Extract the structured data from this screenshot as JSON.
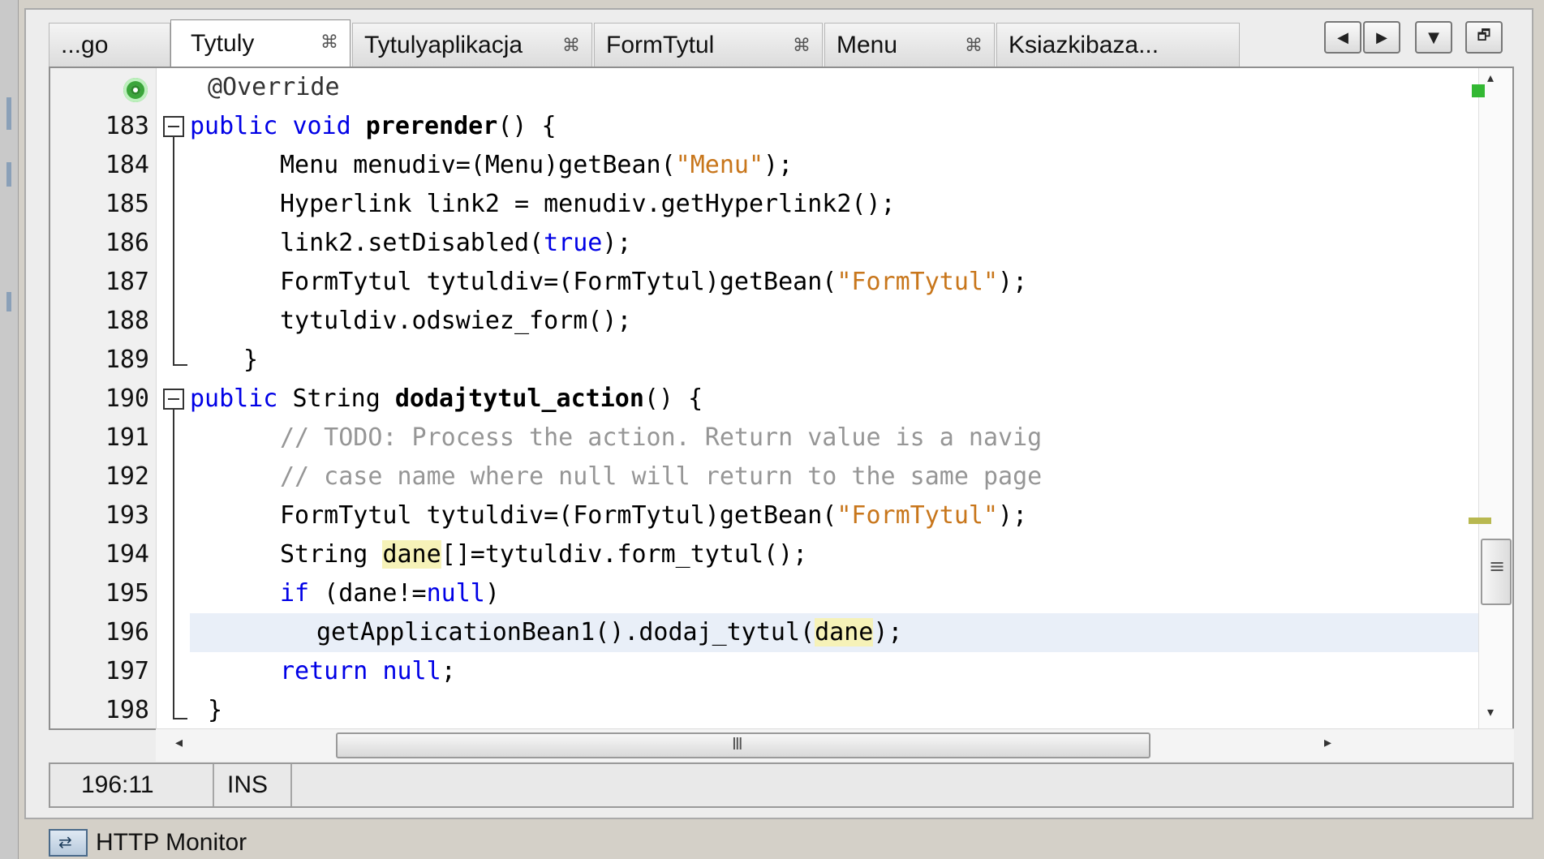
{
  "tabs": [
    {
      "label": "...go",
      "closable": false
    },
    {
      "label": "Tytuly",
      "closable": true,
      "active": true
    },
    {
      "label": "Tytulyaplikacja",
      "closable": true
    },
    {
      "label": "FormTytul",
      "closable": true
    },
    {
      "label": "Menu",
      "closable": true
    },
    {
      "label": "Ksiazkibaza...",
      "closable": false
    }
  ],
  "tab_close_glyph": "⌘",
  "nav": {
    "left": "◀",
    "right": "▶",
    "dropdown": "▼",
    "restore": "🗗"
  },
  "editor": {
    "line_numbers": [
      "",
      "183",
      "184",
      "185",
      "186",
      "187",
      "188",
      "189",
      "190",
      "191",
      "192",
      "193",
      "194",
      "195",
      "196",
      "197",
      "198"
    ],
    "annotation": "@Override",
    "lines": {
      "l183": {
        "kw1": "public",
        "kw2": "void",
        "name": "prerender",
        "rest": "() {"
      },
      "l184": {
        "pre": "Menu menudiv=(Menu)getBean(",
        "str": "\"Menu\"",
        "post": ");"
      },
      "l185": "Hyperlink link2 = menudiv.getHyperlink2();",
      "l186": {
        "pre": "link2.setDisabled(",
        "kw": "true",
        "post": ");"
      },
      "l187": {
        "pre": "FormTytul tytuldiv=(FormTytul)getBean(",
        "str": "\"FormTytul\"",
        "post": ");"
      },
      "l188": "tytuldiv.odswiez_form();",
      "l189": "}",
      "l190": {
        "kw1": "public",
        "type": "String",
        "name": "dodajtytul_action",
        "rest": "() {"
      },
      "l191": "// TODO: Process the action. Return value is a navig",
      "l192": "// case name where null will return to the same page",
      "l193": {
        "pre": "FormTytul tytuldiv=(FormTytul)getBean(",
        "str": "\"FormTytul\"",
        "post": ");"
      },
      "l194": {
        "pre": "String ",
        "hl": "dane",
        "post": "[]=tytuldiv.form_tytul();"
      },
      "l195": {
        "kw": "if",
        "mid": " (dane!=",
        "kw2": "null",
        "post": ")"
      },
      "l196": {
        "pre": "getApplicationBean1().dodaj_tytul(",
        "hl": "dane",
        "post": ");"
      },
      "l197": {
        "kw1": "return",
        "kw2": "null",
        "post": ";"
      },
      "l198": "}"
    },
    "current_line": 196,
    "hscroll_thumb_glyph": "III",
    "hscroll_left": "◂",
    "hscroll_right": "▸",
    "vscroll_up": "▴",
    "vscroll_down": "▾"
  },
  "status": {
    "position": "196:11",
    "mode": "INS"
  },
  "bottom_panel": {
    "label": "HTTP Monitor"
  },
  "colors": {
    "keyword": "#0000e6",
    "string": "#c8761b",
    "comment": "#969696",
    "current_line": "#e9eff8",
    "occurrence_highlight": "#f6f2b8"
  }
}
